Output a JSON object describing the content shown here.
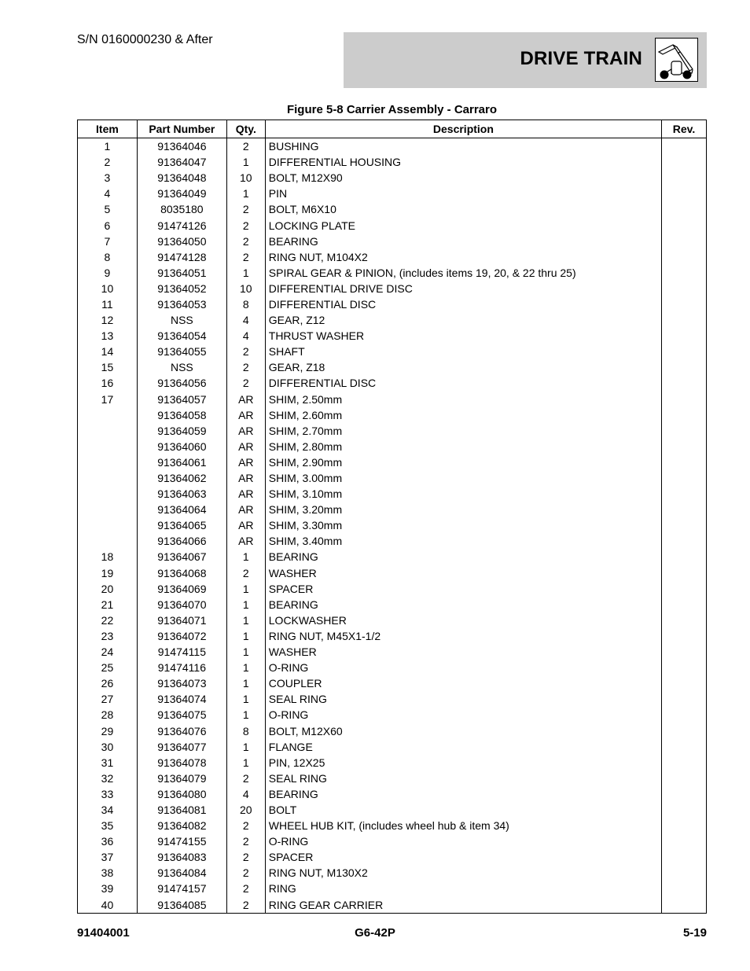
{
  "header": {
    "serial": "S/N 0160000230 & After",
    "section_title": "DRIVE TRAIN",
    "section_icon": "telehandler-icon"
  },
  "figure_title": "Figure 5-8 Carrier Assembly - Carraro",
  "table": {
    "columns": [
      "Item",
      "Part Number",
      "Qty.",
      "Description",
      "Rev."
    ],
    "rows": [
      {
        "item": "1",
        "part": "91364046",
        "qty": "2",
        "desc": "BUSHING",
        "rev": ""
      },
      {
        "item": "2",
        "part": "91364047",
        "qty": "1",
        "desc": "DIFFERENTIAL HOUSING",
        "rev": ""
      },
      {
        "item": "3",
        "part": "91364048",
        "qty": "10",
        "desc": "BOLT, M12X90",
        "rev": ""
      },
      {
        "item": "4",
        "part": "91364049",
        "qty": "1",
        "desc": "PIN",
        "rev": ""
      },
      {
        "item": "5",
        "part": "8035180",
        "qty": "2",
        "desc": "BOLT, M6X10",
        "rev": ""
      },
      {
        "item": "6",
        "part": "91474126",
        "qty": "2",
        "desc": "LOCKING PLATE",
        "rev": ""
      },
      {
        "item": "7",
        "part": "91364050",
        "qty": "2",
        "desc": "BEARING",
        "rev": ""
      },
      {
        "item": "8",
        "part": "91474128",
        "qty": "2",
        "desc": "RING NUT, M104X2",
        "rev": ""
      },
      {
        "item": "9",
        "part": "91364051",
        "qty": "1",
        "desc": "SPIRAL GEAR & PINION, (includes items 19, 20, & 22 thru 25)",
        "rev": ""
      },
      {
        "item": "10",
        "part": "91364052",
        "qty": "10",
        "desc": "DIFFERENTIAL DRIVE DISC",
        "rev": ""
      },
      {
        "item": "11",
        "part": "91364053",
        "qty": "8",
        "desc": "DIFFERENTIAL DISC",
        "rev": ""
      },
      {
        "item": "12",
        "part": "NSS",
        "qty": "4",
        "desc": "GEAR, Z12",
        "rev": ""
      },
      {
        "item": "13",
        "part": "91364054",
        "qty": "4",
        "desc": "THRUST WASHER",
        "rev": ""
      },
      {
        "item": "14",
        "part": "91364055",
        "qty": "2",
        "desc": "SHAFT",
        "rev": ""
      },
      {
        "item": "15",
        "part": "NSS",
        "qty": "2",
        "desc": "GEAR, Z18",
        "rev": ""
      },
      {
        "item": "16",
        "part": "91364056",
        "qty": "2",
        "desc": "DIFFERENTIAL DISC",
        "rev": ""
      },
      {
        "item": "17",
        "part": "91364057",
        "qty": "AR",
        "desc": "SHIM, 2.50mm",
        "rev": ""
      },
      {
        "item": "",
        "part": "91364058",
        "qty": "AR",
        "desc": "SHIM, 2.60mm",
        "rev": ""
      },
      {
        "item": "",
        "part": "91364059",
        "qty": "AR",
        "desc": "SHIM, 2.70mm",
        "rev": ""
      },
      {
        "item": "",
        "part": "91364060",
        "qty": "AR",
        "desc": "SHIM, 2.80mm",
        "rev": ""
      },
      {
        "item": "",
        "part": "91364061",
        "qty": "AR",
        "desc": "SHIM, 2.90mm",
        "rev": ""
      },
      {
        "item": "",
        "part": "91364062",
        "qty": "AR",
        "desc": "SHIM, 3.00mm",
        "rev": ""
      },
      {
        "item": "",
        "part": "91364063",
        "qty": "AR",
        "desc": "SHIM, 3.10mm",
        "rev": ""
      },
      {
        "item": "",
        "part": "91364064",
        "qty": "AR",
        "desc": "SHIM, 3.20mm",
        "rev": ""
      },
      {
        "item": "",
        "part": "91364065",
        "qty": "AR",
        "desc": "SHIM, 3.30mm",
        "rev": ""
      },
      {
        "item": "",
        "part": "91364066",
        "qty": "AR",
        "desc": "SHIM, 3.40mm",
        "rev": ""
      },
      {
        "item": "18",
        "part": "91364067",
        "qty": "1",
        "desc": "BEARING",
        "rev": ""
      },
      {
        "item": "19",
        "part": "91364068",
        "qty": "2",
        "desc": "WASHER",
        "rev": ""
      },
      {
        "item": "20",
        "part": "91364069",
        "qty": "1",
        "desc": "SPACER",
        "rev": ""
      },
      {
        "item": "21",
        "part": "91364070",
        "qty": "1",
        "desc": "BEARING",
        "rev": ""
      },
      {
        "item": "22",
        "part": "91364071",
        "qty": "1",
        "desc": "LOCKWASHER",
        "rev": ""
      },
      {
        "item": "23",
        "part": "91364072",
        "qty": "1",
        "desc": "RING NUT, M45X1-1/2",
        "rev": ""
      },
      {
        "item": "24",
        "part": "91474115",
        "qty": "1",
        "desc": "WASHER",
        "rev": ""
      },
      {
        "item": "25",
        "part": "91474116",
        "qty": "1",
        "desc": "O-RING",
        "rev": ""
      },
      {
        "item": "26",
        "part": "91364073",
        "qty": "1",
        "desc": "COUPLER",
        "rev": ""
      },
      {
        "item": "27",
        "part": "91364074",
        "qty": "1",
        "desc": "SEAL RING",
        "rev": ""
      },
      {
        "item": "28",
        "part": "91364075",
        "qty": "1",
        "desc": "O-RING",
        "rev": ""
      },
      {
        "item": "29",
        "part": "91364076",
        "qty": "8",
        "desc": "BOLT, M12X60",
        "rev": ""
      },
      {
        "item": "30",
        "part": "91364077",
        "qty": "1",
        "desc": "FLANGE",
        "rev": ""
      },
      {
        "item": "31",
        "part": "91364078",
        "qty": "1",
        "desc": "PIN, 12X25",
        "rev": ""
      },
      {
        "item": "32",
        "part": "91364079",
        "qty": "2",
        "desc": "SEAL RING",
        "rev": ""
      },
      {
        "item": "33",
        "part": "91364080",
        "qty": "4",
        "desc": "BEARING",
        "rev": ""
      },
      {
        "item": "34",
        "part": "91364081",
        "qty": "20",
        "desc": "BOLT",
        "rev": ""
      },
      {
        "item": "35",
        "part": "91364082",
        "qty": "2",
        "desc": "WHEEL HUB KIT, (includes wheel hub & item 34)",
        "rev": ""
      },
      {
        "item": "36",
        "part": "91474155",
        "qty": "2",
        "desc": "O-RING",
        "rev": ""
      },
      {
        "item": "37",
        "part": "91364083",
        "qty": "2",
        "desc": "SPACER",
        "rev": ""
      },
      {
        "item": "38",
        "part": "91364084",
        "qty": "2",
        "desc": "RING NUT, M130X2",
        "rev": ""
      },
      {
        "item": "39",
        "part": "91474157",
        "qty": "2",
        "desc": "RING",
        "rev": ""
      },
      {
        "item": "40",
        "part": "91364085",
        "qty": "2",
        "desc": "RING GEAR CARRIER",
        "rev": ""
      }
    ]
  },
  "footer": {
    "doc_number": "91404001",
    "model": "G6-42P",
    "page": "5-19"
  }
}
